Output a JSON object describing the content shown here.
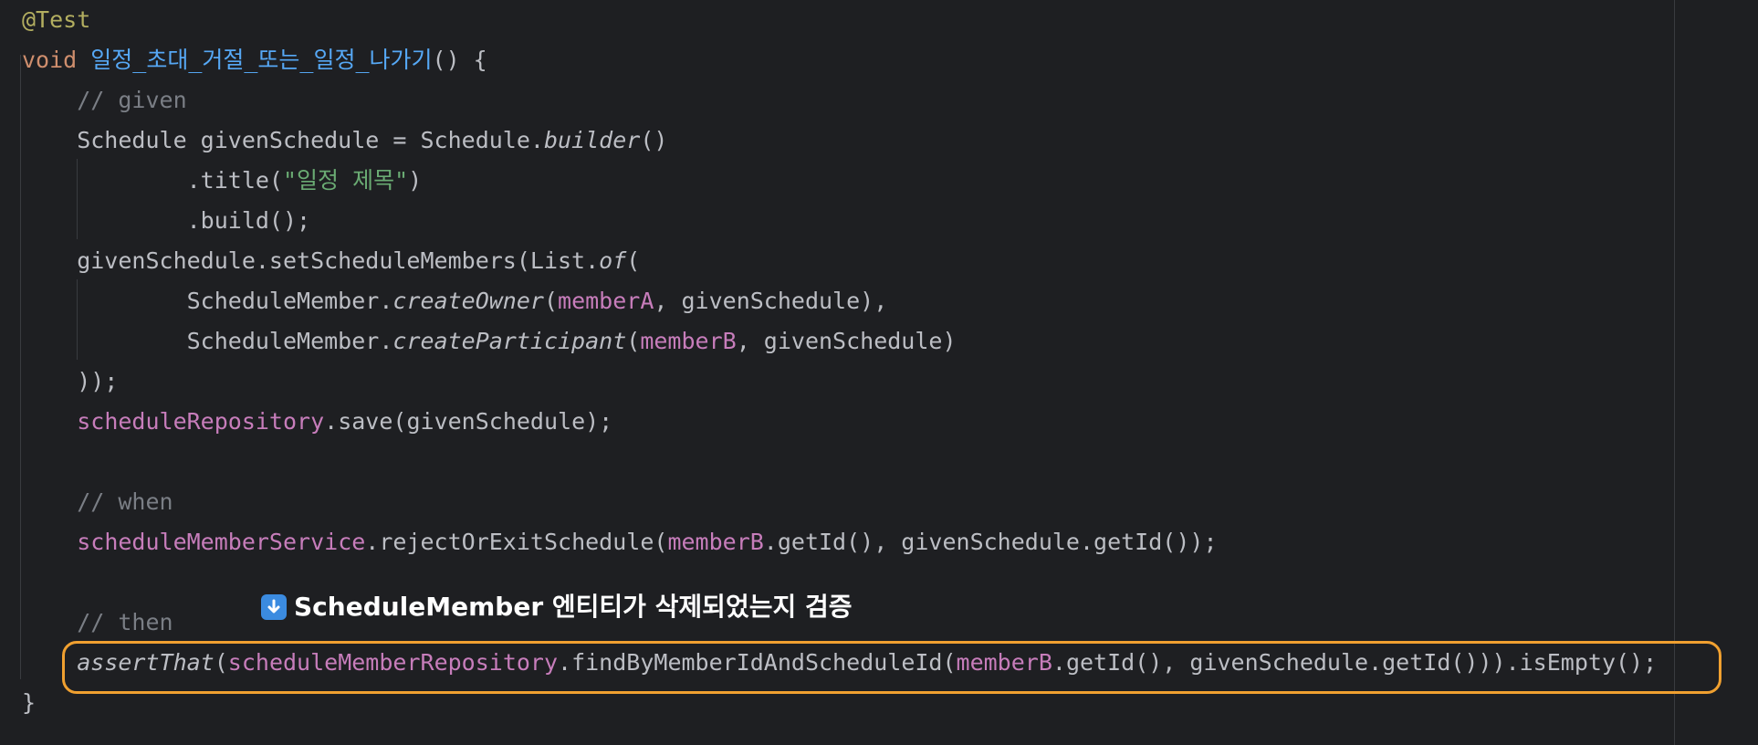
{
  "code": {
    "lines": [
      [
        {
          "t": "@Test",
          "c": "ann"
        }
      ],
      [
        {
          "t": "void ",
          "c": "kw"
        },
        {
          "t": "일정_초대_거절_또는_일정_나가기",
          "c": "fn"
        },
        {
          "t": "() {",
          "c": "plain"
        }
      ],
      [
        {
          "t": "    // given",
          "c": "com"
        }
      ],
      [
        {
          "t": "    Schedule givenSchedule = Schedule.",
          "c": "plain"
        },
        {
          "t": "builder",
          "c": "italic"
        },
        {
          "t": "()",
          "c": "plain"
        }
      ],
      [
        {
          "t": "            .title(",
          "c": "plain"
        },
        {
          "t": "\"일정 제목\"",
          "c": "str"
        },
        {
          "t": ")",
          "c": "plain"
        }
      ],
      [
        {
          "t": "            .build();",
          "c": "plain"
        }
      ],
      [
        {
          "t": "    givenSchedule.setScheduleMembers(List.",
          "c": "plain"
        },
        {
          "t": "of",
          "c": "italic"
        },
        {
          "t": "(",
          "c": "plain"
        }
      ],
      [
        {
          "t": "            ScheduleMember.",
          "c": "plain"
        },
        {
          "t": "createOwner",
          "c": "italic"
        },
        {
          "t": "(",
          "c": "plain"
        },
        {
          "t": "memberA",
          "c": "field"
        },
        {
          "t": ", givenSchedule),",
          "c": "plain"
        }
      ],
      [
        {
          "t": "            ScheduleMember.",
          "c": "plain"
        },
        {
          "t": "createParticipant",
          "c": "italic"
        },
        {
          "t": "(",
          "c": "plain"
        },
        {
          "t": "memberB",
          "c": "field"
        },
        {
          "t": ", givenSchedule)",
          "c": "plain"
        }
      ],
      [
        {
          "t": "    ));",
          "c": "plain"
        }
      ],
      [
        {
          "t": "    ",
          "c": "plain"
        },
        {
          "t": "scheduleRepository",
          "c": "field"
        },
        {
          "t": ".save(givenSchedule);",
          "c": "plain"
        }
      ],
      [],
      [
        {
          "t": "    // when",
          "c": "com"
        }
      ],
      [
        {
          "t": "    ",
          "c": "plain"
        },
        {
          "t": "scheduleMemberService",
          "c": "field"
        },
        {
          "t": ".rejectOrExitSchedule(",
          "c": "plain"
        },
        {
          "t": "memberB",
          "c": "field"
        },
        {
          "t": ".getId(), givenSchedule.getId());",
          "c": "plain"
        }
      ],
      [],
      [
        {
          "t": "    // then",
          "c": "com"
        }
      ],
      [
        {
          "t": "    ",
          "c": "plain"
        },
        {
          "t": "assertThat",
          "c": "italic"
        },
        {
          "t": "(",
          "c": "plain"
        },
        {
          "t": "scheduleMemberRepository",
          "c": "field"
        },
        {
          "t": ".findByMemberIdAndScheduleId(",
          "c": "plain"
        },
        {
          "t": "memberB",
          "c": "field"
        },
        {
          "t": ".getId(), givenSchedule.getId())).isEmpty();",
          "c": "plain"
        }
      ],
      [
        {
          "t": "}",
          "c": "plain"
        }
      ]
    ]
  },
  "annotation": {
    "icon": "arrow-down-icon",
    "text": "ScheduleMember 엔티티가 삭제되었는지 검증",
    "highlight_color": "#f0a030"
  },
  "colors": {
    "background": "#1e1f22",
    "annotation": "#b3ae60",
    "keyword": "#cf8e6d",
    "method_declaration": "#56a8f5",
    "plain": "#bcbec4",
    "field": "#c77dbb",
    "string": "#6aab73",
    "comment": "#7a7e85"
  }
}
